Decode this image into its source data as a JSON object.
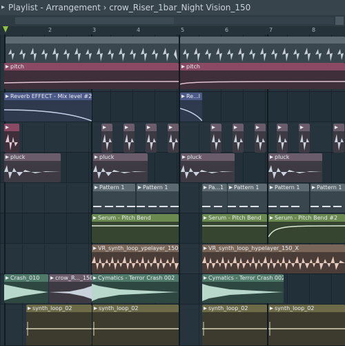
{
  "window": {
    "title": "Playlist - Arrangement",
    "separator": "›",
    "pattern": "crow_Riser_1bar_Night Vision_150",
    "arrow": "▸"
  },
  "ruler": {
    "labels": [
      "2",
      "3",
      "4",
      "5",
      "6",
      "7",
      "8"
    ]
  },
  "clips": {
    "pitch_a": "pitch",
    "pitch_b": "pitch",
    "reverb_a": "Reverb EFFECT - Mix level #2",
    "reverb_b": "Re...l",
    "pluck_a": "pluck",
    "pluck_b": "pluck",
    "pluck_c": "pluck",
    "pluck_d": "pluck",
    "pattern_a": "Pattern 1",
    "pattern_b": "Pattern 1",
    "pattern_c": "Pa...1",
    "pattern_d": "Pattern 1",
    "pattern_e": "Pattern 1",
    "pattern_f": "Pattern 1",
    "serum_a": "Serum - Pitch Bend",
    "serum_b": "Serum - Pitch Bend",
    "serum_c": "Serum - Pitch Bend #2",
    "vr_a": "VR_synth_loop_ypelayer_150_X",
    "vr_b": "VR_synth_loop_hypelayer_150_X",
    "crash_a": "Crash_010",
    "crow_a": "crow_R..._150",
    "cym_a": "Cymatics - Terror Crash 002",
    "cym_b": "Cymatics - Terror Crash 002",
    "synth_a": "synth_loop_02",
    "synth_b": "synth_loop_02",
    "synth_c": "synth_loop_02",
    "synth_d": "synth_loop_02"
  }
}
